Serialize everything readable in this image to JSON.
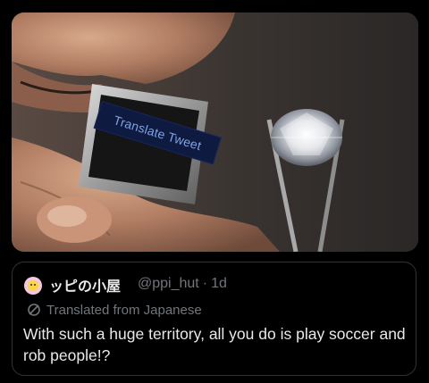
{
  "photo": {
    "overlay_label": "Translate Tweet",
    "overlay_bg": "#0e1a40",
    "overlay_text_color": "#7fa3e6"
  },
  "tweet": {
    "display_name": "ッピの小屋",
    "handle": "@ppi_hut",
    "separator": "·",
    "time": "1d",
    "translated_label": "Translated from Japanese",
    "text": "With such a huge territory, all you do is play soccer and rob people!?",
    "colors": {
      "primary_text": "#e7e9ea",
      "secondary_text": "#71767b",
      "border": "#2f3336",
      "background": "#000000"
    }
  },
  "icons": {
    "avatar": "avatar",
    "translate": "globe-slash-icon"
  }
}
